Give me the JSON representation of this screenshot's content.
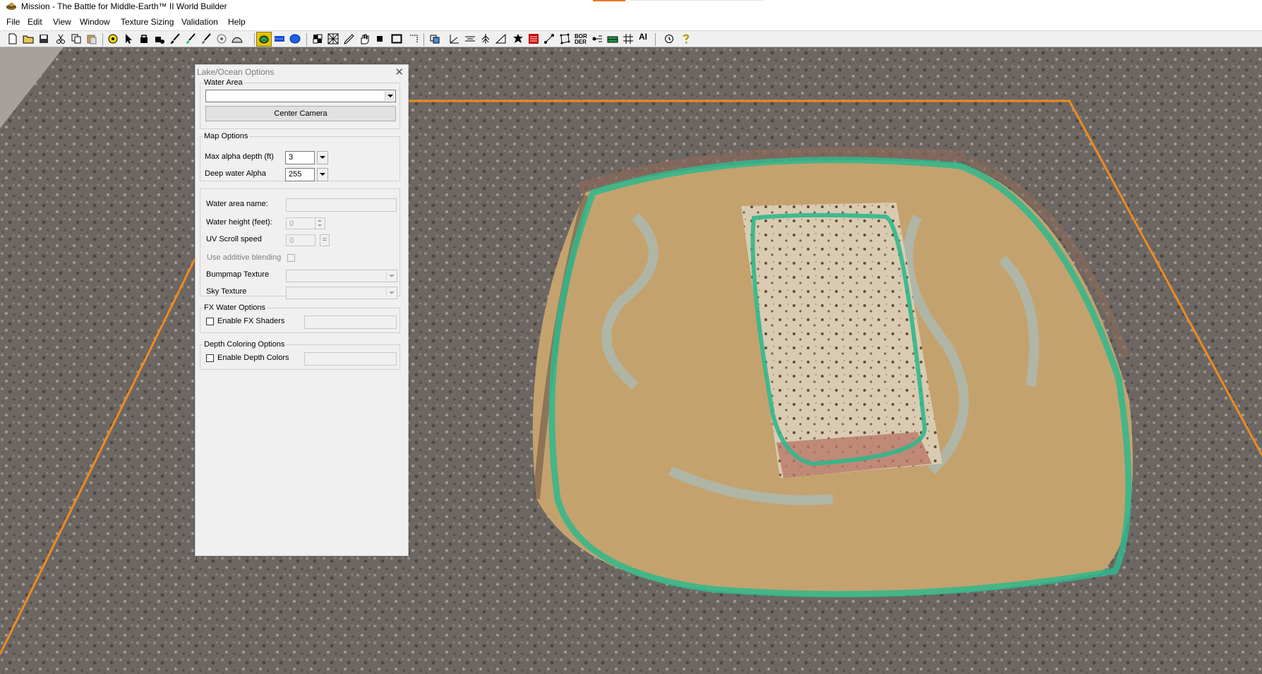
{
  "window": {
    "title": "Mission - The Battle for Middle-Earth™ II World Builder",
    "icon": "worldbuilder-app-icon"
  },
  "menu": [
    "File",
    "Edit",
    "View",
    "Window",
    "Texture Sizing",
    "Validation",
    "Help"
  ],
  "toolbar": {
    "pressed_tool": "water-tool-icon",
    "text_buttons": {
      "border": "BOR DER",
      "ai": "AI"
    }
  },
  "dialog": {
    "title": "Lake/Ocean Options",
    "water_area": {
      "group": "Water Area",
      "selected": "",
      "center_camera": "Center Camera"
    },
    "map_options": {
      "group": "Map Options",
      "max_alpha_label": "Max alpha depth (ft)",
      "max_alpha_value": "3",
      "deep_alpha_label": "Deep water Alpha",
      "deep_alpha_value": "255"
    },
    "props": {
      "name_label": "Water area name:",
      "name_value": "",
      "height_label": "Water height (feet):",
      "height_value": "0",
      "uv_label": "UV Scroll speed",
      "uv_value": "0",
      "uv_button": "=",
      "additive_label": "Use additive blending",
      "bumpmap_label": "Bumpmap Texture",
      "sky_label": "Sky Texture"
    },
    "fx": {
      "group": "FX Water Options",
      "enable_label": "Enable FX Shaders"
    },
    "depth": {
      "group": "Depth Coloring Options",
      "enable_label": "Enable Depth Colors"
    }
  },
  "colors": {
    "map_boundary": "#f08a1e",
    "water_outline": "#2fb88c",
    "pressed_tool": "#e5c200"
  }
}
